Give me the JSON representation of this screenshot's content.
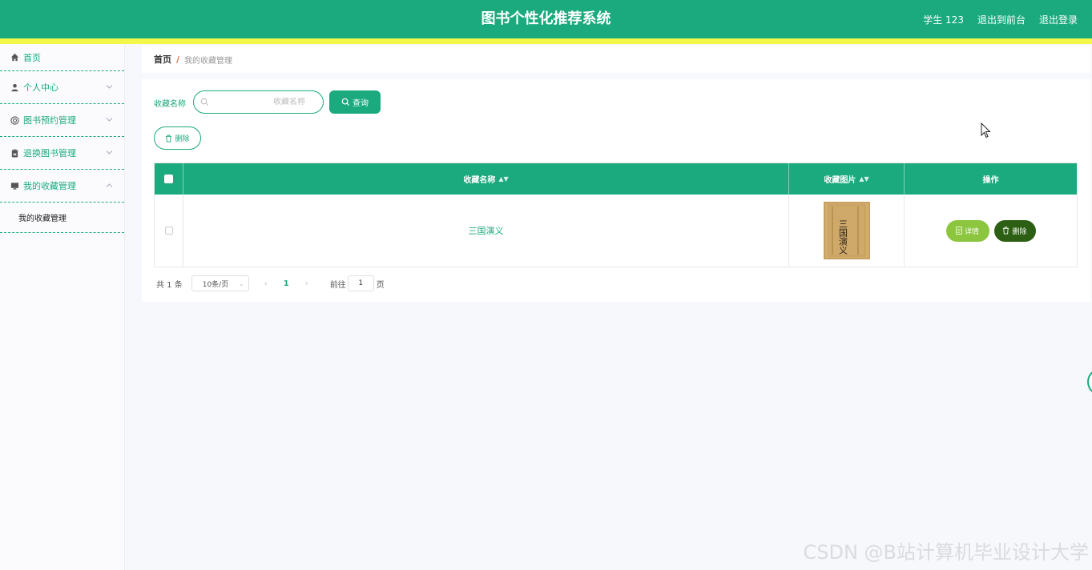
{
  "header": {
    "title": "图书个性化推荐系统",
    "user": "学生 123",
    "back_to_front": "退出到前台",
    "logout": "退出登录"
  },
  "sidebar": {
    "items": [
      {
        "label": "首页",
        "icon": "home-icon"
      },
      {
        "label": "个人中心",
        "icon": "user-icon"
      },
      {
        "label": "图书预约管理",
        "icon": "lifebuoy-icon"
      },
      {
        "label": "退换图书管理",
        "icon": "clipboard-icon"
      },
      {
        "label": "我的收藏管理",
        "icon": "monitor-icon",
        "expanded": true
      }
    ],
    "submenu": [
      "我的收藏管理"
    ]
  },
  "breadcrumb": {
    "home": "首页",
    "separator": "/",
    "current": "我的收藏管理"
  },
  "search": {
    "label": "收藏名称",
    "placeholder": "收藏名称",
    "value": "",
    "button": "查询"
  },
  "toolbar": {
    "delete": "删除"
  },
  "table": {
    "columns": [
      "收藏名称",
      "收藏图片",
      "操作"
    ],
    "rows": [
      {
        "name": "三国演义",
        "image_text": "三国演义",
        "actions": [
          "详情",
          "删除"
        ]
      }
    ]
  },
  "pagination": {
    "total": "共 1 条",
    "page_size": "10条/页",
    "current_page": "1",
    "goto_label": "前往",
    "goto_value": "1",
    "page_suffix": "页"
  },
  "watermark": "CSDN @B站计算机毕业设计大学",
  "colors": {
    "primary": "#1aaa7e",
    "accent_bar": "#f2f74a",
    "detail": "#8cc63f",
    "remove": "#2c5f14"
  }
}
